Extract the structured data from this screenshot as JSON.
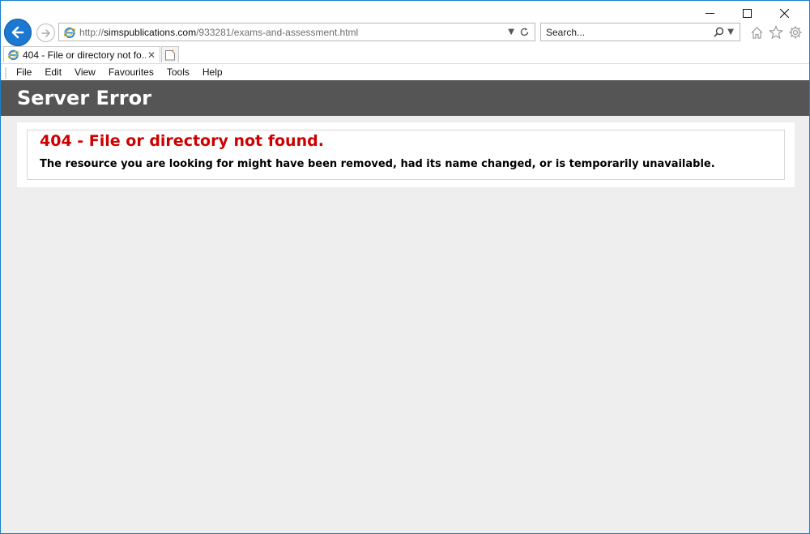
{
  "window": {
    "controls": [
      "minimize",
      "maximize",
      "close"
    ]
  },
  "address": {
    "url_prefix": "http://",
    "url_host": "simspublications.com",
    "url_path": "/933281/exams-and-assessment.html"
  },
  "search": {
    "placeholder": "Search..."
  },
  "toolbar_icons": [
    "home-icon",
    "favorites-star-icon",
    "settings-gear-icon"
  ],
  "tab": {
    "title": "404 - File or directory not fo...",
    "close_glyph": "✕"
  },
  "menu": {
    "items": [
      "File",
      "Edit",
      "View",
      "Favourites",
      "Tools",
      "Help"
    ]
  },
  "page": {
    "header": "Server Error",
    "error_title": "404 - File or directory not found.",
    "error_description": "The resource you are looking for might have been removed, had its name changed, or is temporarily unavailable."
  },
  "colors": {
    "accent_blue": "#1b79d1",
    "header_band": "#555555",
    "error_red": "#cc0000",
    "page_bg": "#eeeeee"
  }
}
